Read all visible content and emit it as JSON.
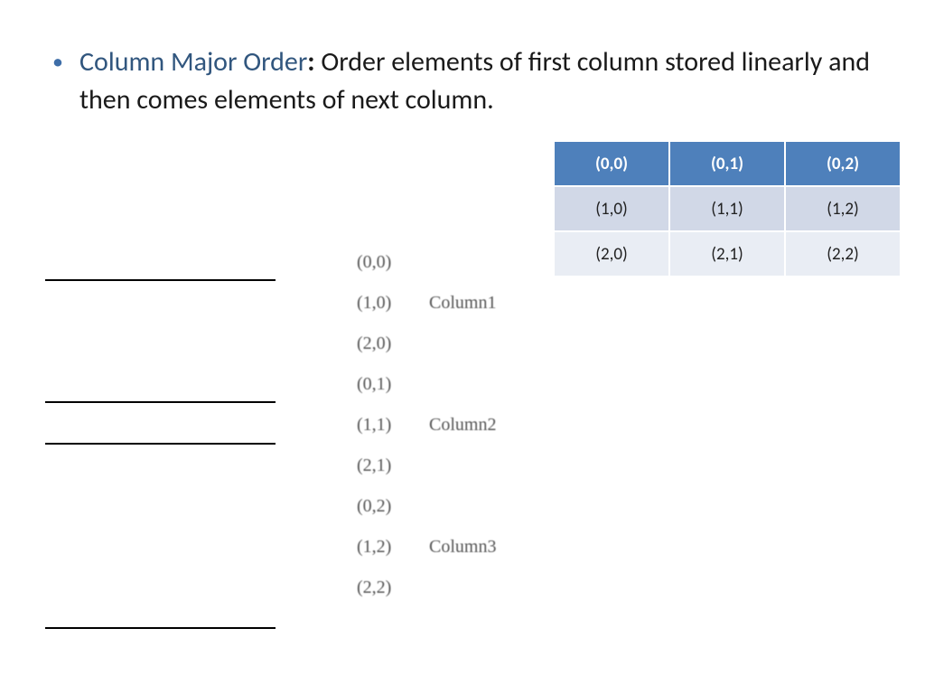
{
  "bullet": {
    "term": "Column Major Order",
    "colon": ": ",
    "rest": "Order elements of first column stored linearly and then comes elements of next column."
  },
  "matrix": {
    "r0": {
      "c0": "(0,0)",
      "c1": "(0,1)",
      "c2": "(0,2)"
    },
    "r1": {
      "c0": "(1,0)",
      "c1": "(1,1)",
      "c2": "(1,2)"
    },
    "r2": {
      "c0": "(2,0)",
      "c1": "(2,1)",
      "c2": "(2,2)"
    }
  },
  "linear": {
    "i0": {
      "cell": "(0,0)",
      "lab": ""
    },
    "i1": {
      "cell": "(1,0)",
      "lab": "Column1"
    },
    "i2": {
      "cell": "(2,0)",
      "lab": ""
    },
    "i3": {
      "cell": "(0,1)",
      "lab": ""
    },
    "i4": {
      "cell": "(1,1)",
      "lab": "Column2"
    },
    "i5": {
      "cell": "(2,1)",
      "lab": ""
    },
    "i6": {
      "cell": "(0,2)",
      "lab": ""
    },
    "i7": {
      "cell": "(1,2)",
      "lab": "Column3"
    },
    "i8": {
      "cell": "(2,2)",
      "lab": ""
    }
  }
}
